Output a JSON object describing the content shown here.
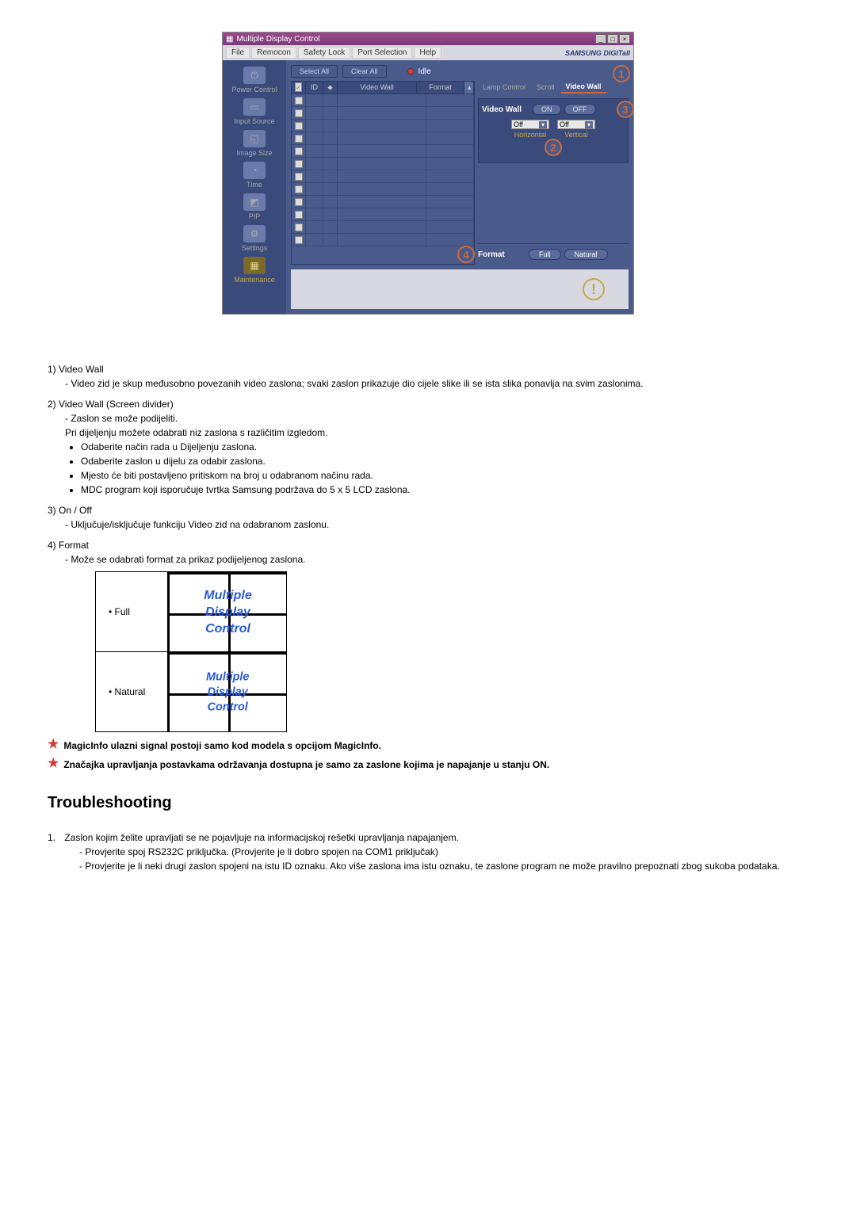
{
  "app": {
    "title": "Multiple Display Control",
    "brand": "SAMSUNG DIGITall",
    "menu": {
      "file": "File",
      "remocon": "Remocon",
      "safety": "Safety Lock",
      "port": "Port Selection",
      "help": "Help"
    },
    "toolbar": {
      "selectAll": "Select All",
      "clearAll": "Clear All",
      "idle": "Idle"
    },
    "table": {
      "id": "ID",
      "videoWall": "Video Wall",
      "format": "Format"
    },
    "sidebar": {
      "power": "Power Control",
      "input": "Input Source",
      "image": "Image Size",
      "time": "Time",
      "pip": "PIP",
      "settings": "Settings",
      "maintenance": "Maintenance"
    },
    "right": {
      "tabs": {
        "lamp": "Lamp Control",
        "scroll": "Scroll",
        "videowall": "Video Wall"
      },
      "videoWallLabel": "Video Wall",
      "on": "ON",
      "off_btn": "OFF",
      "horiz": "Horizontal",
      "vert": "Vertical",
      "off": "Off",
      "formatLabel": "Format",
      "full": "Full",
      "natural": "Natural"
    },
    "marker": {
      "m1": "1",
      "m2": "2",
      "m3": "3",
      "m4": "4"
    }
  },
  "doc": {
    "s1": {
      "num": "1)",
      "title": "Video Wall",
      "desc": "- Video zid je skup međusobno povezanih video zaslona; svaki zaslon prikazuje dio cijele slike ili se ista slika ponavlja na svim zaslonima."
    },
    "s2": {
      "num": "2)",
      "title": "Video Wall (Screen divider)",
      "d1": "- Zaslon se može podijeliti.",
      "d2": "Pri dijeljenju možete odabrati niz zaslona s različitim izgledom.",
      "b1": "Odaberite način rada u Dijeljenju zaslona.",
      "b2": "Odaberite zaslon u dijelu za odabir zaslona.",
      "b3": "Mjesto će biti postavljeno pritiskom na broj u odabranom načinu rada.",
      "b4": "MDC program koji isporučuje tvrtka Samsung podržava do 5 x 5 LCD zaslona."
    },
    "s3": {
      "num": "3)",
      "title": "On / Off",
      "desc": "- Uključuje/isključuje funkciju Video zid na odabranom zaslonu."
    },
    "s4": {
      "num": "4)",
      "title": "Format",
      "desc": "- Može se odabrati format za prikaz podijeljenog zaslona.",
      "full": "Full",
      "natural": "Natural",
      "mdc_line1": "Multiple",
      "mdc_line2": "Display",
      "mdc_line3": "Control"
    },
    "note1": "MagicInfo ulazni signal postoji samo kod modela s opcijom MagicInfo.",
    "note2": "Značajka upravljanja postavkama održavanja dostupna je samo za zaslone kojima je napajanje u stanju ON.",
    "troubleHeading": "Troubleshooting",
    "t1": {
      "num": "1.",
      "text": "Zaslon kojim želite upravljati se ne pojavljuje na informacijskoj rešetki upravljanja napajanjem.",
      "sub1": "- Provjerite spoj RS232C priključka. (Provjerite je li dobro spojen na COM1 priključak)",
      "sub2": "- Provjerite je li neki drugi zaslon spojeni na istu ID oznaku. Ako više zaslona ima istu oznaku, te zaslone program ne može pravilno prepoznati zbog sukoba podataka."
    }
  }
}
